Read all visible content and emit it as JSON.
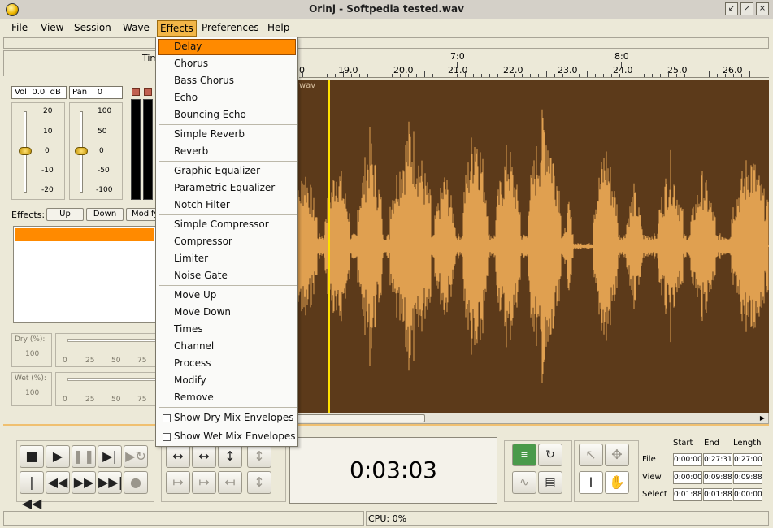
{
  "window": {
    "title": "Orinj - Softpedia tested.wav"
  },
  "menubar": [
    "File",
    "View",
    "Session",
    "Wave",
    "Effects",
    "Preferences",
    "Help"
  ],
  "effects_menu": {
    "highlighted": "Delay",
    "groups": [
      [
        "Delay",
        "Chorus",
        "Bass Chorus",
        "Echo",
        "Bouncing Echo"
      ],
      [
        "Simple Reverb",
        "Reverb"
      ],
      [
        "Graphic Equalizer",
        "Parametric Equalizer",
        "Notch Filter"
      ],
      [
        "Simple Compressor",
        "Compressor",
        "Limiter",
        "Noise Gate"
      ],
      [
        "Move Up",
        "Move Down",
        "Times",
        "Channel",
        "Process",
        "Modify",
        "Remove"
      ]
    ],
    "checks": [
      "Show Dry Mix Envelopes",
      "Show Wet Mix Envelopes"
    ]
  },
  "ruler": {
    "prefix": "Tim",
    "major": [
      "7:0",
      "8:0"
    ],
    "minor": [
      "0",
      "19.0",
      "20.0",
      "21.0",
      "22.0",
      "23.0",
      "24.0",
      "25.0",
      "26.0"
    ]
  },
  "track": {
    "name_fragment": "wav"
  },
  "left_panel": {
    "vol_label": "Vol",
    "vol_value": "0.0",
    "vol_unit": "dB",
    "pan_label": "Pan",
    "pan_value": "0",
    "vol_scale": [
      "20",
      "10",
      "0",
      "-10",
      "-20"
    ],
    "pan_scale": [
      "100",
      "50",
      "0",
      "-50",
      "-100"
    ],
    "effects_label": "Effects:",
    "up_label": "Up",
    "down_label": "Down",
    "modify_label": "Modify",
    "dry_label": "Dry (%):",
    "dry_value": "100",
    "wet_label": "Wet (%):",
    "wet_value": "100",
    "slider_scale": [
      "0",
      "25",
      "50",
      "75"
    ]
  },
  "time_display": "0:03:03",
  "position_grid": {
    "headers": [
      "Start",
      "End",
      "Length"
    ],
    "rows": [
      {
        "label": "File",
        "values": [
          "0:00:00",
          "0:27:31",
          "0:27:00"
        ]
      },
      {
        "label": "View",
        "values": [
          "0:00:00",
          "0:09:88",
          "0:09:88"
        ]
      },
      {
        "label": "Select",
        "values": [
          "0:01:88",
          "0:01:88",
          "0:00:00"
        ]
      }
    ]
  },
  "status": {
    "cpu": "CPU: 0%"
  },
  "colors": {
    "wave_bg": "#5c3a1a",
    "wave_fg": "#e0a050",
    "playhead": "#ffe000",
    "menu_highlight": "#ff8a00"
  }
}
